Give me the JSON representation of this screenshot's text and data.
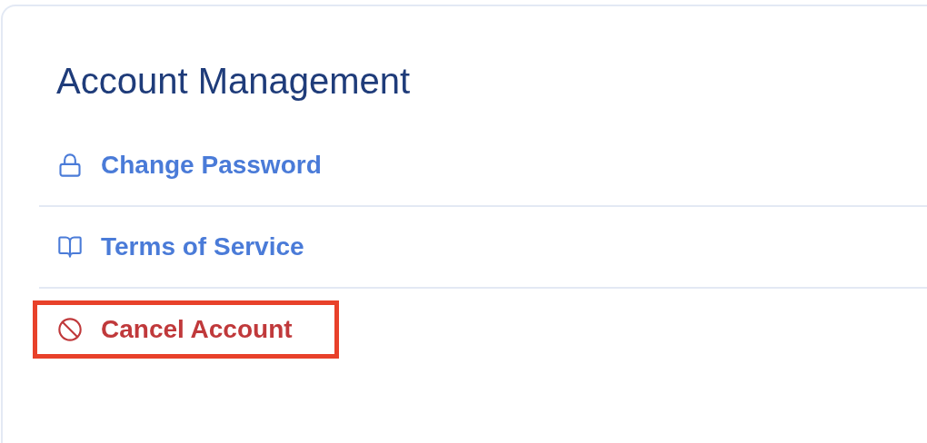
{
  "title": "Account Management",
  "items": [
    {
      "label": "Change Password",
      "kind": "normal",
      "highlighted": false
    },
    {
      "label": "Terms of Service",
      "kind": "normal",
      "highlighted": false
    },
    {
      "label": "Cancel Account",
      "kind": "danger",
      "highlighted": true
    }
  ]
}
